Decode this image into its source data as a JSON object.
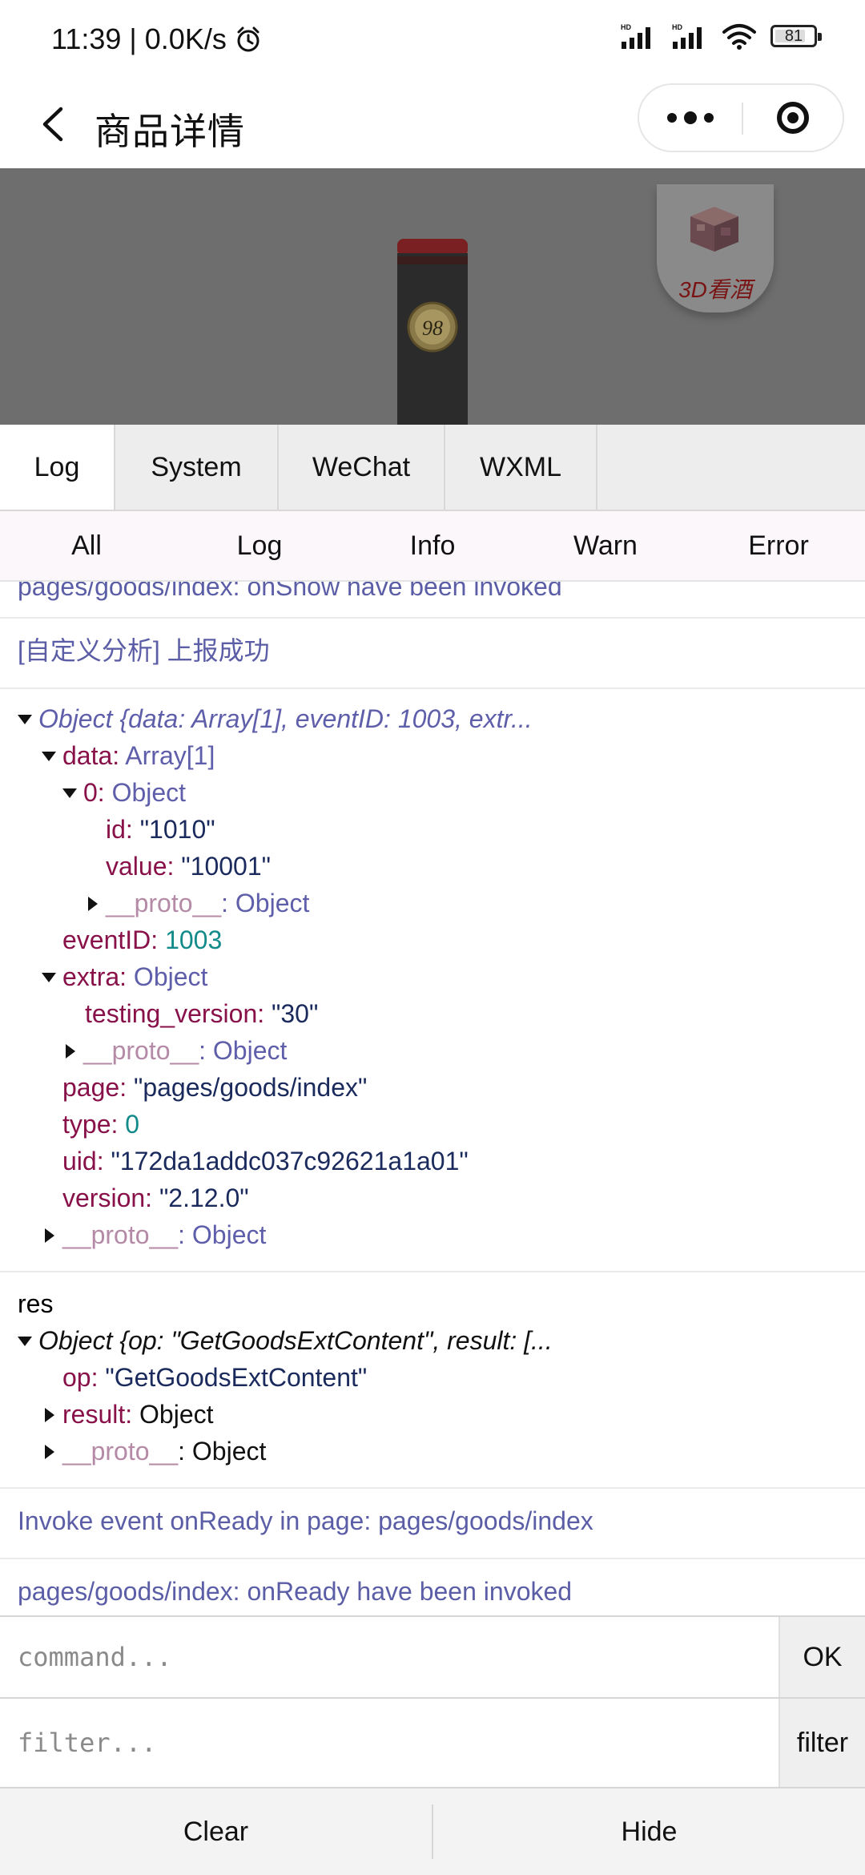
{
  "status_bar": {
    "time": "11:39",
    "separator": "|",
    "speed": "0.0K/s",
    "network_label_1": "HD",
    "network_label_2": "HD",
    "battery": "81",
    "battery_level": 0.81
  },
  "nav": {
    "title": "商品详情"
  },
  "product": {
    "ar_label": "3D看酒",
    "bottle_label": "98"
  },
  "console": {
    "tabs": [
      "Log",
      "System",
      "WeChat",
      "WXML"
    ],
    "filters": [
      "All",
      "Log",
      "Info",
      "Warn",
      "Error"
    ],
    "logs": {
      "cut_line": "pages/goods/index: onShow have been invoked",
      "analysis": "[自定义分析] 上报成功",
      "obj1_summary": "Object {data: Array[1], eventID: 1003, extr...",
      "k_data": "data",
      "v_data": "Array[1]",
      "k_0": "0",
      "v_0": "Object",
      "k_id": "id",
      "v_id": "\"1010\"",
      "k_value": "value",
      "v_value": "\"10001\"",
      "k_proto": "__proto__",
      "v_proto": "Object",
      "k_eventID": "eventID",
      "v_eventID": "1003",
      "k_extra": "extra",
      "v_extra": "Object",
      "k_testing": "testing_version",
      "v_testing": "\"30\"",
      "k_page": "page",
      "v_page": "\"pages/goods/index\"",
      "k_type": "type",
      "v_type": "0",
      "k_uid": "uid",
      "v_uid": "\"172da1addc037c92621a1a01\"",
      "k_version": "version",
      "v_version": "\"2.12.0\"",
      "res_label": "res",
      "obj2_summary": "Object {op: \"GetGoodsExtContent\", result: [...",
      "k_op": "op",
      "v_op": "\"GetGoodsExtContent\"",
      "k_result": "result",
      "v_result": "Object",
      "onready_invoke": "Invoke event onReady in page: pages/goods/index",
      "onready_done": "pages/goods/index: onReady have been invoked"
    },
    "command_placeholder": "command...",
    "ok_label": "OK",
    "filter_placeholder": "filter...",
    "filter_label": "filter",
    "clear_label": "Clear",
    "hide_label": "Hide"
  }
}
